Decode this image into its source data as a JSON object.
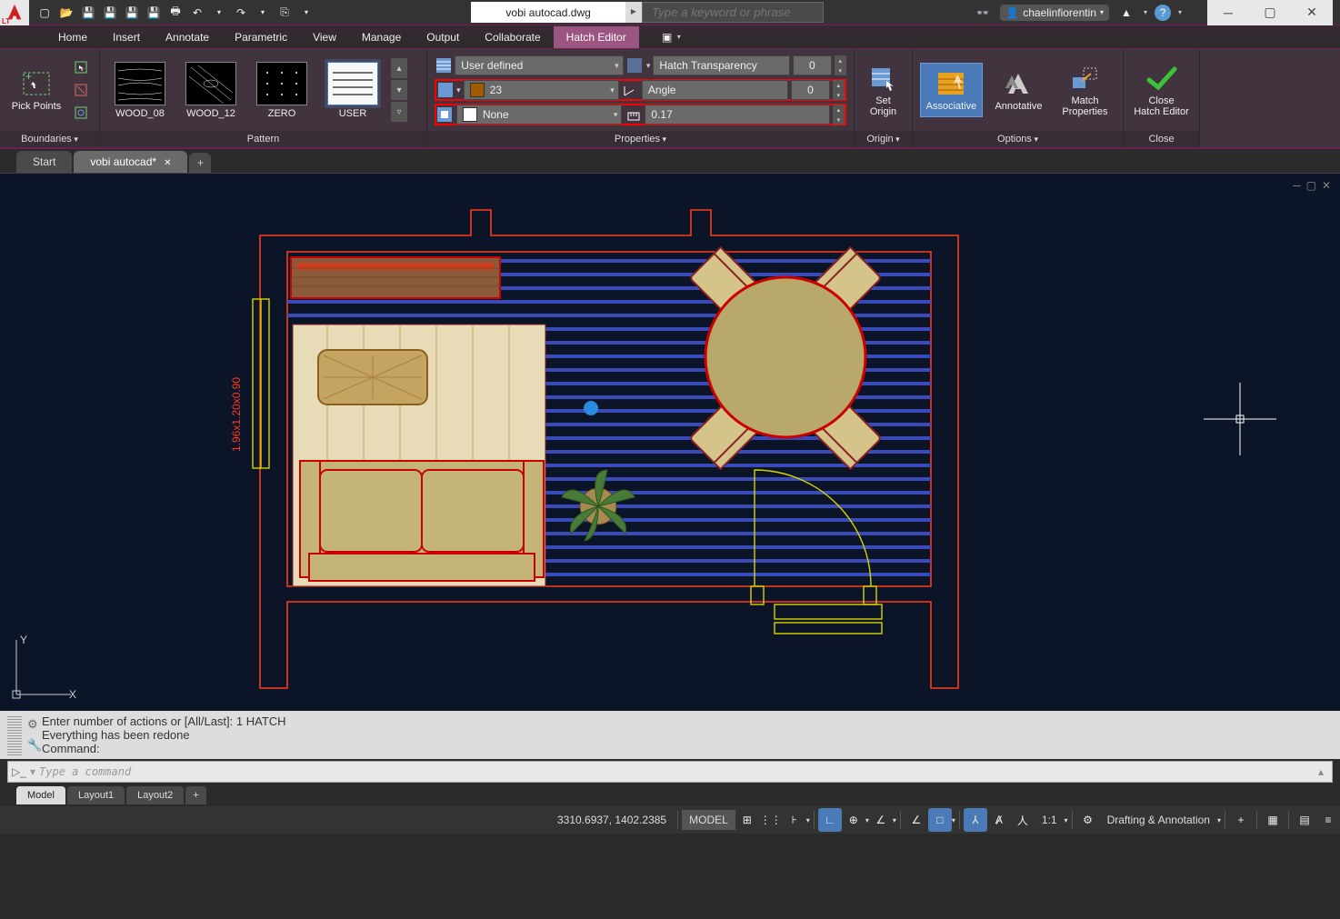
{
  "title": {
    "doc": "vobi autocad.dwg",
    "search_placeholder": "Type a keyword or phrase",
    "user": "chaelinfiorentin"
  },
  "menu": {
    "items": [
      "Home",
      "Insert",
      "Annotate",
      "Parametric",
      "View",
      "Manage",
      "Output",
      "Collaborate",
      "Hatch Editor"
    ],
    "active": "Hatch Editor"
  },
  "ribbon": {
    "boundaries": {
      "title": "Boundaries",
      "pick_points": "Pick Points"
    },
    "pattern": {
      "title": "Pattern",
      "items": [
        "WOOD_08",
        "WOOD_12",
        "ZERO",
        "USER"
      ],
      "selected": "USER"
    },
    "properties": {
      "title": "Properties",
      "type": "User defined",
      "color_value": "23",
      "bg_value": "None",
      "transparency_label": "Hatch Transparency",
      "transparency_value": "0",
      "angle_label": "Angle",
      "angle_value": "0",
      "scale_value": "0.17"
    },
    "origin": {
      "title": "Origin",
      "set_origin": "Set\nOrigin"
    },
    "options": {
      "title": "Options",
      "associative": "Associative",
      "annotative": "Annotative",
      "match_props": "Match\nProperties"
    },
    "close": {
      "title": "Close",
      "label": "Close\nHatch Editor"
    }
  },
  "doc_tabs": {
    "start": "Start",
    "active": "vobi autocad*",
    "add": "+"
  },
  "drawing": {
    "dim_text": "1.96x1.20x0.90"
  },
  "cmd_history": {
    "line1": "Enter number of actions or [All/Last]: 1 HATCH",
    "line2": "Everything has been redone",
    "line3": "Command:"
  },
  "cmd_input_placeholder": "Type a command",
  "layout_tabs": [
    "Model",
    "Layout1",
    "Layout2"
  ],
  "status": {
    "coords": "3310.6937, 1402.2385",
    "space": "MODEL",
    "scale": "1:1",
    "workspace": "Drafting & Annotation"
  }
}
